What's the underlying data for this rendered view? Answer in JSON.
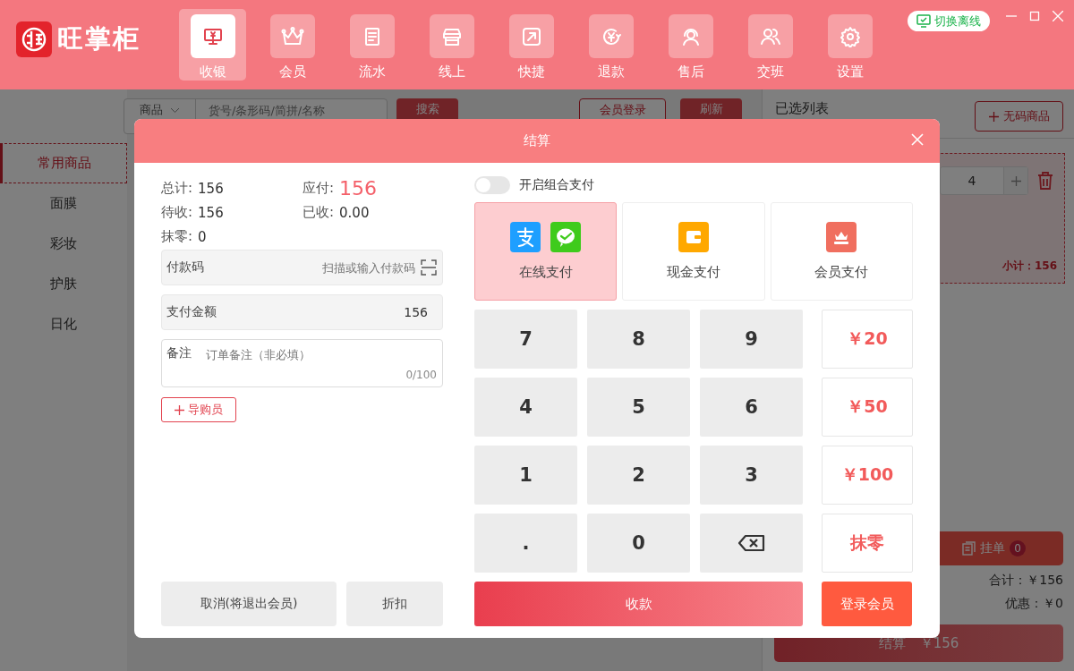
{
  "header": {
    "logo": "旺掌柜",
    "nav": [
      {
        "label": "收银",
        "kind": "cashier",
        "selected": true
      },
      {
        "label": "会员",
        "kind": "crown",
        "selected": false
      },
      {
        "label": "流水",
        "kind": "ledger",
        "selected": false
      },
      {
        "label": "线上",
        "kind": "shop",
        "selected": false
      },
      {
        "label": "快捷",
        "kind": "quick",
        "selected": false
      },
      {
        "label": "退款",
        "kind": "refund",
        "selected": false
      },
      {
        "label": "售后",
        "kind": "service",
        "selected": false
      },
      {
        "label": "交班",
        "kind": "shift",
        "selected": false
      },
      {
        "label": "设置",
        "kind": "settings",
        "selected": false
      }
    ],
    "offline_button": "切换离线"
  },
  "sidebar": {
    "categories": [
      {
        "label": "常用商品",
        "selected": true
      },
      {
        "label": "面膜",
        "selected": false
      },
      {
        "label": "彩妆",
        "selected": false
      },
      {
        "label": "护肤",
        "selected": false
      },
      {
        "label": "日化",
        "selected": false
      }
    ]
  },
  "toolbar": {
    "scope": "商品",
    "search_placeholder": "货号/条形码/简拼/名称",
    "search_button": "搜索",
    "member_login": "会员登录",
    "refresh": "刷新"
  },
  "cart": {
    "title": "已选列表",
    "add_button": "无码商品",
    "quantity": "4",
    "subtotal": "小计：156",
    "hold_button": "挂单",
    "hold_count": "0",
    "total": "合计：￥156",
    "discount": "优惠：￥0",
    "checkout_button": "结算",
    "checkout_amount": "￥156"
  },
  "dialog": {
    "title": "结算",
    "summary": [
      {
        "label": "总计:",
        "value": "156",
        "highlight": false
      },
      {
        "label": "应付:",
        "value": "156",
        "highlight": true
      },
      {
        "label": "待收:",
        "value": "156",
        "highlight": false
      },
      {
        "label": "已收:",
        "value": "0.00",
        "highlight": false
      },
      {
        "label": "抹零:",
        "value": "0",
        "highlight": false
      }
    ],
    "payment_code": {
      "label": "付款码",
      "placeholder": "扫描或输入付款码"
    },
    "amount": {
      "label": "支付金额",
      "value": "156"
    },
    "note": {
      "label": "备注",
      "placeholder": "订单备注（非必填）",
      "counter": "0/100"
    },
    "guide_button": "导购员",
    "cancel_button": "取消(将退出会员)",
    "discount_button": "折扣",
    "combo_toggle": {
      "label": "开启组合支付",
      "on": false
    },
    "methods": [
      {
        "label": "在线支付",
        "kind": "online",
        "selected": true
      },
      {
        "label": "现金支付",
        "kind": "cash",
        "selected": false
      },
      {
        "label": "会员支付",
        "kind": "member",
        "selected": false
      }
    ],
    "keys": [
      {
        "label": "7",
        "kind": "digit"
      },
      {
        "label": "8",
        "kind": "digit"
      },
      {
        "label": "9",
        "kind": "digit"
      },
      {
        "label": "￥20",
        "kind": "quick"
      },
      {
        "label": "4",
        "kind": "digit"
      },
      {
        "label": "5",
        "kind": "digit"
      },
      {
        "label": "6",
        "kind": "digit"
      },
      {
        "label": "￥50",
        "kind": "quick"
      },
      {
        "label": "1",
        "kind": "digit"
      },
      {
        "label": "2",
        "kind": "digit"
      },
      {
        "label": "3",
        "kind": "digit"
      },
      {
        "label": "￥100",
        "kind": "quick"
      },
      {
        "label": ".",
        "kind": "digit"
      },
      {
        "label": "0",
        "kind": "digit"
      },
      {
        "kind": "backspace"
      },
      {
        "label": "抹零",
        "kind": "quick"
      }
    ],
    "collect_button": "收款",
    "login_member_button": "登录会员"
  }
}
